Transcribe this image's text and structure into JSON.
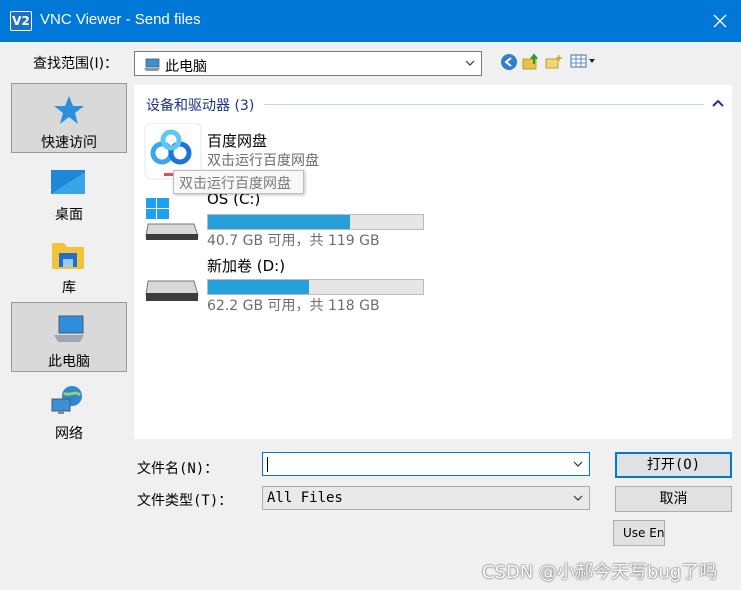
{
  "window": {
    "title": "VNC Viewer - Send files",
    "app_icon_text": "V2"
  },
  "lookin": {
    "label": "查找范围(I)：",
    "value": "此电脑"
  },
  "places": [
    {
      "label": "快速访问",
      "icon": "star-icon"
    },
    {
      "label": "桌面",
      "icon": "desktop-icon"
    },
    {
      "label": "库",
      "icon": "library-icon"
    },
    {
      "label": "此电脑",
      "icon": "computer-icon"
    },
    {
      "label": "网络",
      "icon": "network-icon"
    }
  ],
  "group": {
    "header": "设备和驱动器 (3)"
  },
  "items": [
    {
      "name": "百度网盘",
      "subtitle": "双击运行百度网盘"
    },
    {
      "name": "OS (C:)",
      "usage": "40.7 GB 可用，共 119 GB",
      "used_fraction": 0.66
    },
    {
      "name": "新加卷 (D:)",
      "usage": "62.2 GB 可用，共 118 GB",
      "used_fraction": 0.47
    }
  ],
  "tooltip": "双击运行百度网盘",
  "filename": {
    "label": "文件名(N)：",
    "value": ""
  },
  "filetype": {
    "label": "文件类型(T)：",
    "value": "All Files"
  },
  "buttons": {
    "open": "打开(O)",
    "cancel": "取消",
    "use": "Use Ent"
  },
  "watermark": "CSDN @小郝今天写bug了吗",
  "colors": {
    "titlebar": "#0078d7",
    "progress": "#26a0da",
    "group_header": "#1e3287"
  }
}
